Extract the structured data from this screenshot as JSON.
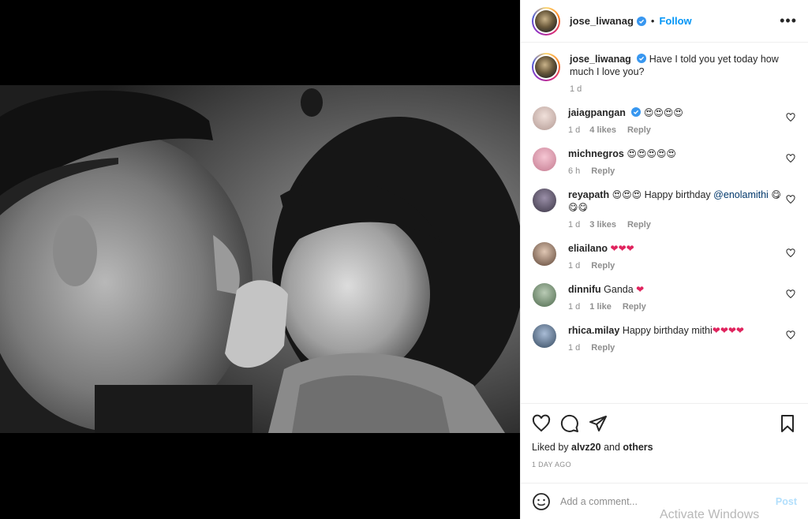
{
  "post": {
    "username": "jose_liwanag",
    "follow_label": "Follow",
    "dot": "•",
    "more": "•••",
    "caption": "Have I told you yet today how much I love you?",
    "caption_time": "1 d"
  },
  "comments": [
    {
      "user": "jaiagpangan",
      "verified": true,
      "text": "",
      "emoji": "😍😍😍😍",
      "time": "1 d",
      "likes": "4 likes",
      "reply": "Reply",
      "avatar_color": "#d9c8c2"
    },
    {
      "user": "michnegros",
      "verified": false,
      "text": "",
      "emoji": "😍😍😍😍😍",
      "time": "6 h",
      "likes": "",
      "reply": "Reply",
      "avatar_color": "#e8a6b8"
    },
    {
      "user": "reyapath",
      "verified": false,
      "text": "Happy birthday",
      "emoji_before": "😍😍😍",
      "mention": "@enolamithi",
      "emoji_after": "😋😋😋",
      "time": "1 d",
      "likes": "3 likes",
      "reply": "Reply",
      "avatar_color": "#5c5466"
    },
    {
      "user": "eliailano",
      "verified": false,
      "text": "",
      "emoji": "❤❤❤",
      "time": "1 d",
      "likes": "",
      "reply": "Reply",
      "avatar_color": "#8a6a55"
    },
    {
      "user": "dinnifu",
      "verified": false,
      "text": "Ganda",
      "emoji": "❤",
      "time": "1 d",
      "likes": "1 like",
      "reply": "Reply",
      "avatar_color": "#6b8a6a"
    },
    {
      "user": "rhica.milay",
      "verified": false,
      "text": "Happy birthday mithi",
      "emoji": "❤❤❤❤",
      "time": "1 d",
      "likes": "",
      "reply": "Reply",
      "avatar_color": "#4a5f7a"
    }
  ],
  "actions": {
    "liked_by_prefix": "Liked by",
    "liked_by_user": "alvz20",
    "and": "and",
    "others": "others",
    "age": "1 DAY AGO"
  },
  "add_comment": {
    "placeholder": "Add a comment...",
    "post_label": "Post"
  },
  "watermark": "Activate Windows",
  "icons": [
    "heart-icon",
    "comment-icon",
    "share-icon",
    "bookmark-icon",
    "smiley-icon",
    "verified-icon",
    "more-icon"
  ]
}
